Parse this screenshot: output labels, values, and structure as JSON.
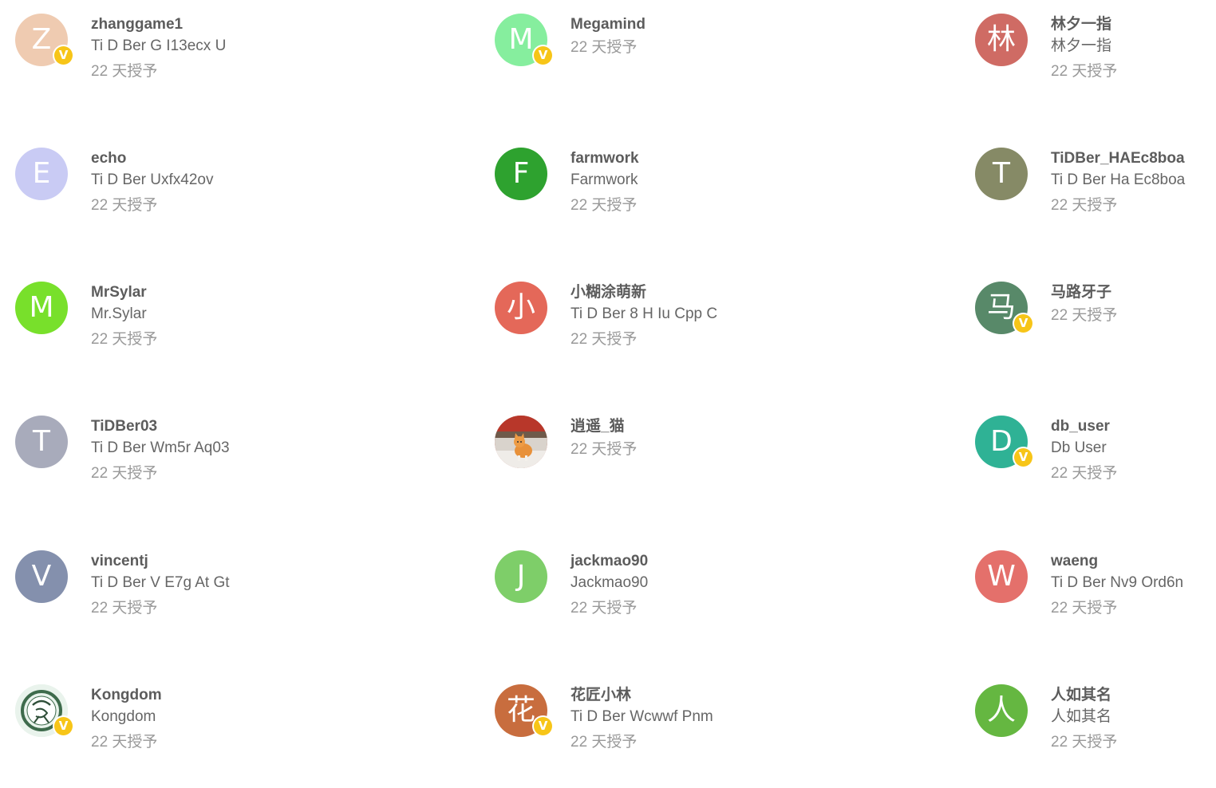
{
  "badge_label": "V",
  "users": [
    {
      "username": "zhanggame1",
      "display_name": "Ti D Ber G I13ecx U",
      "granted": "22 天授予",
      "initial": "Z",
      "color": "#efcbb1",
      "verified": true,
      "avatar_type": "letter"
    },
    {
      "username": "Megamind",
      "display_name": "",
      "granted": "22 天授予",
      "initial": "M",
      "color": "#86ee9e",
      "verified": true,
      "avatar_type": "letter"
    },
    {
      "username": "林夕一指",
      "display_name": "林夕一指",
      "granted": "22 天授予",
      "initial": "林",
      "color": "#cf6b64",
      "verified": false,
      "avatar_type": "letter"
    },
    {
      "username": "echo",
      "display_name": "Ti D Ber Uxfx42ov",
      "granted": "22 天授予",
      "initial": "E",
      "color": "#c9cbf4",
      "verified": false,
      "avatar_type": "letter"
    },
    {
      "username": "farmwork",
      "display_name": "Farmwork",
      "granted": "22 天授予",
      "initial": "F",
      "color": "#2ea22f",
      "verified": false,
      "avatar_type": "letter"
    },
    {
      "username": "TiDBer_HAEc8boa",
      "display_name": "Ti D Ber Ha Ec8boa",
      "granted": "22 天授予",
      "initial": "T",
      "color": "#868a66",
      "verified": false,
      "avatar_type": "letter"
    },
    {
      "username": "MrSylar",
      "display_name": "Mr.Sylar",
      "granted": "22 天授予",
      "initial": "M",
      "color": "#78e02b",
      "verified": false,
      "avatar_type": "letter"
    },
    {
      "username": "小糊涂萌新",
      "display_name": "Ti D Ber 8 H Iu Cpp C",
      "granted": "22 天授予",
      "initial": "小",
      "color": "#e46859",
      "verified": false,
      "avatar_type": "letter"
    },
    {
      "username": "马路牙子",
      "display_name": "",
      "granted": "22 天授予",
      "initial": "马",
      "color": "#588969",
      "verified": true,
      "avatar_type": "letter"
    },
    {
      "username": "TiDBer03",
      "display_name": "Ti D Ber Wm5r Aq03",
      "granted": "22 天授予",
      "initial": "T",
      "color": "#a8abbb",
      "verified": false,
      "avatar_type": "letter"
    },
    {
      "username": "逍遥_猫",
      "display_name": "",
      "granted": "22 天授予",
      "initial": "",
      "color": "#c0392b",
      "verified": false,
      "avatar_type": "photo-cat"
    },
    {
      "username": "db_user",
      "display_name": "Db User",
      "granted": "22 天授予",
      "initial": "D",
      "color": "#2fb295",
      "verified": true,
      "avatar_type": "letter"
    },
    {
      "username": "vincentj",
      "display_name": "Ti D Ber V E7g At Gt",
      "granted": "22 天授予",
      "initial": "V",
      "color": "#8490ad",
      "verified": false,
      "avatar_type": "letter"
    },
    {
      "username": "jackmao90",
      "display_name": "Jackmao90",
      "granted": "22 天授予",
      "initial": "J",
      "color": "#7ece69",
      "verified": false,
      "avatar_type": "letter"
    },
    {
      "username": "waeng",
      "display_name": "Ti D Ber Nv9 Ord6n",
      "granted": "22 天授予",
      "initial": "W",
      "color": "#e4706b",
      "verified": false,
      "avatar_type": "letter"
    },
    {
      "username": "Kongdom",
      "display_name": "Kongdom",
      "granted": "22 天授予",
      "initial": "",
      "color": "#e6f2ea",
      "verified": true,
      "avatar_type": "emblem"
    },
    {
      "username": "花匠小林",
      "display_name": "Ti D Ber Wcwwf Pnm",
      "granted": "22 天授予",
      "initial": "花",
      "color": "#c86d3e",
      "verified": true,
      "avatar_type": "letter"
    },
    {
      "username": "人如其名",
      "display_name": "人如其名",
      "granted": "22 天授予",
      "initial": "人",
      "color": "#65b741",
      "verified": false,
      "avatar_type": "letter"
    }
  ]
}
